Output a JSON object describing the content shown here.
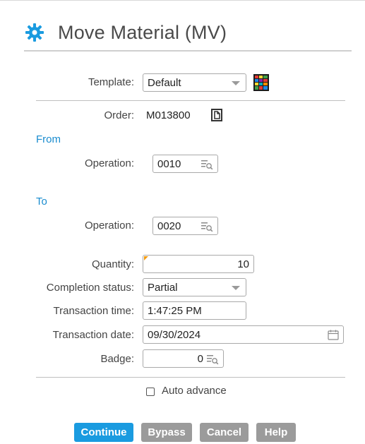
{
  "header": {
    "title": "Move Material (MV)",
    "icon": "gear-icon",
    "icon_color": "#1a9be0"
  },
  "template": {
    "label": "Template:",
    "value": "Default",
    "icon": "template-grid-icon"
  },
  "order": {
    "label": "Order:",
    "value": "M013800",
    "icon": "copy-document-icon"
  },
  "from": {
    "heading": "From",
    "operation_label": "Operation:",
    "operation_value": "0010",
    "icon": "lookup-icon"
  },
  "to": {
    "heading": "To",
    "operation_label": "Operation:",
    "operation_value": "0020",
    "icon": "lookup-icon"
  },
  "quantity": {
    "label": "Quantity:",
    "value": "10"
  },
  "completion_status": {
    "label": "Completion status:",
    "value": "Partial"
  },
  "transaction_time": {
    "label": "Transaction time:",
    "value": "1:47:25 PM"
  },
  "transaction_date": {
    "label": "Transaction date:",
    "value": "09/30/2024",
    "icon": "calendar-icon"
  },
  "badge": {
    "label": "Badge:",
    "value": "0",
    "icon": "lookup-icon"
  },
  "auto_advance": {
    "label": "Auto advance",
    "checked": false
  },
  "buttons": {
    "continue": "Continue",
    "bypass": "Bypass",
    "cancel": "Cancel",
    "help": "Help"
  },
  "colors": {
    "primary": "#1a9be0",
    "secondary": "#9b9b9b",
    "link": "#1a8ccf",
    "required": "#f39c12"
  }
}
